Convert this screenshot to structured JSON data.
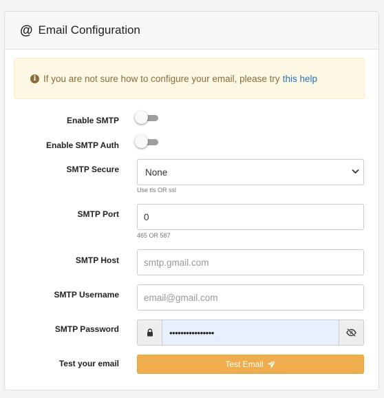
{
  "panel": {
    "title": "Email Configuration",
    "icon": "at-icon"
  },
  "alert": {
    "text": "If you are not sure how to configure your email, please try",
    "link_text": "this help",
    "icon": "info-icon"
  },
  "form": {
    "enable_smtp": {
      "label": "Enable SMTP",
      "checked": false
    },
    "enable_smtp_auth": {
      "label": "Enable SMTP Auth",
      "checked": false
    },
    "smtp_secure": {
      "label": "SMTP Secure",
      "value": "None",
      "help": "Use tls OR ssl"
    },
    "smtp_port": {
      "label": "SMTP Port",
      "value": "0",
      "help": "465 OR 587"
    },
    "smtp_host": {
      "label": "SMTP Host",
      "placeholder": "smtp.gmail.com"
    },
    "smtp_username": {
      "label": "SMTP Username",
      "placeholder": "email@gmail.com"
    },
    "smtp_password": {
      "label": "SMTP Password",
      "value": "••••••••••••••••"
    },
    "test": {
      "label": "Test your email",
      "button": "Test Email"
    }
  },
  "colors": {
    "warning": "#f0ad4e",
    "alert_bg": "#fcf8e3",
    "link": "#2a6ebb"
  }
}
